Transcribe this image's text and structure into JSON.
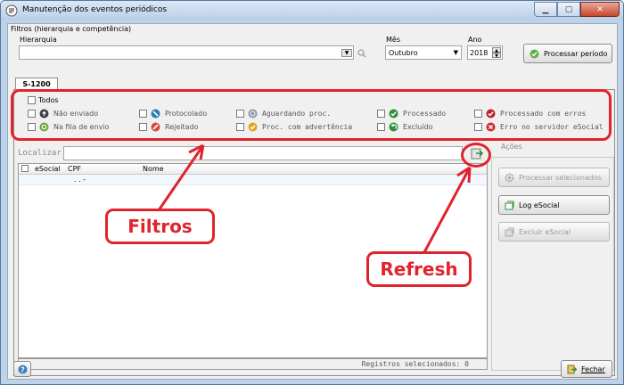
{
  "window": {
    "title": "Manutenção dos eventos periódicos"
  },
  "filters": {
    "group_label": "Filtros (hierarquia e competência)",
    "hierarquia_label": "Hierarquia",
    "hierarquia_value": "",
    "mes_label": "Mês",
    "mes_value": "Outubro",
    "ano_label": "Ano",
    "ano_value": "2018",
    "process_button": "Processar período"
  },
  "tab": {
    "label": "S-1200"
  },
  "status": {
    "all_label": "Todos",
    "items": [
      {
        "label": "Não enviado",
        "color": "#3b3f45"
      },
      {
        "label": "Protocolado",
        "color": "#2d7bb0"
      },
      {
        "label": "Aguardando proc.",
        "color": "#8b98a5"
      },
      {
        "label": "Processado",
        "color": "#2f8f3a"
      },
      {
        "label": "Processado com erros",
        "color": "#c0202e"
      },
      {
        "label": "Na fila de envio",
        "color": "#6aa53a"
      },
      {
        "label": "Rejeitado",
        "color": "#d14a3b"
      },
      {
        "label": "Proc. com advertência",
        "color": "#e0a21f"
      },
      {
        "label": "Excluído",
        "color": "#2f8f3a"
      },
      {
        "label": "Erro no servidor eSocial",
        "color": "#d12a2a"
      }
    ]
  },
  "search": {
    "label": "Localizar",
    "value": ""
  },
  "grid": {
    "columns": [
      "eSocial",
      "CPF",
      "Nome"
    ],
    "row_cpf": ". . -",
    "footer": "Registros selecionados: 0"
  },
  "actions": {
    "label": "Ações",
    "processar": "Processar selecionados",
    "log": "Log eSocial",
    "excluir": "Excluir eSocial"
  },
  "bottom": {
    "close": "Fechar"
  },
  "annotations": {
    "filtros": "Filtros",
    "refresh": "Refresh",
    "color": "#e0232c"
  }
}
